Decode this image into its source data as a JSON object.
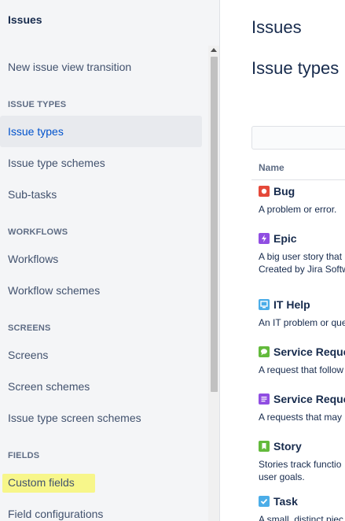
{
  "sidebar": {
    "title": "Issues",
    "items": [
      {
        "label": "New issue view transition"
      },
      {
        "heading": "ISSUE TYPES"
      },
      {
        "label": "Issue types",
        "selected": true
      },
      {
        "label": "Issue type schemes"
      },
      {
        "label": "Sub-tasks"
      },
      {
        "heading": "WORKFLOWS"
      },
      {
        "label": "Workflows"
      },
      {
        "label": "Workflow schemes"
      },
      {
        "heading": "SCREENS"
      },
      {
        "label": "Screens"
      },
      {
        "label": "Screen schemes"
      },
      {
        "label": "Issue type screen schemes"
      },
      {
        "heading": "FIELDS"
      },
      {
        "label": "Custom fields",
        "highlighted": true
      },
      {
        "label": "Field configurations"
      }
    ]
  },
  "main": {
    "title": "Issues",
    "section_title": "Issue types",
    "table": {
      "column_name": "Name",
      "rows": [
        {
          "name": "Bug",
          "desc": "A problem or error.",
          "icon": "bug-icon",
          "color": "#e5493a"
        },
        {
          "name": "Epic",
          "desc": "A big user story that\nCreated by Jira Softw",
          "icon": "epic-icon",
          "color": "#904ee2"
        },
        {
          "name": "IT Help",
          "desc": "An IT problem or que",
          "icon": "it-help-icon",
          "color": "#4bade8"
        },
        {
          "name": "Service Reque",
          "desc": "A request that follow",
          "icon": "service-request-icon",
          "color": "#63ba3c"
        },
        {
          "name": "Service Reque",
          "desc": "A requests that may",
          "icon": "service-request-approval-icon",
          "color": "#904ee2"
        },
        {
          "name": "Story",
          "desc": "Stories track functio\nuser goals.",
          "icon": "story-icon",
          "color": "#63ba3c"
        },
        {
          "name": "Task",
          "desc": "A small, distinct piec",
          "icon": "task-icon",
          "color": "#4bade8"
        }
      ]
    }
  }
}
